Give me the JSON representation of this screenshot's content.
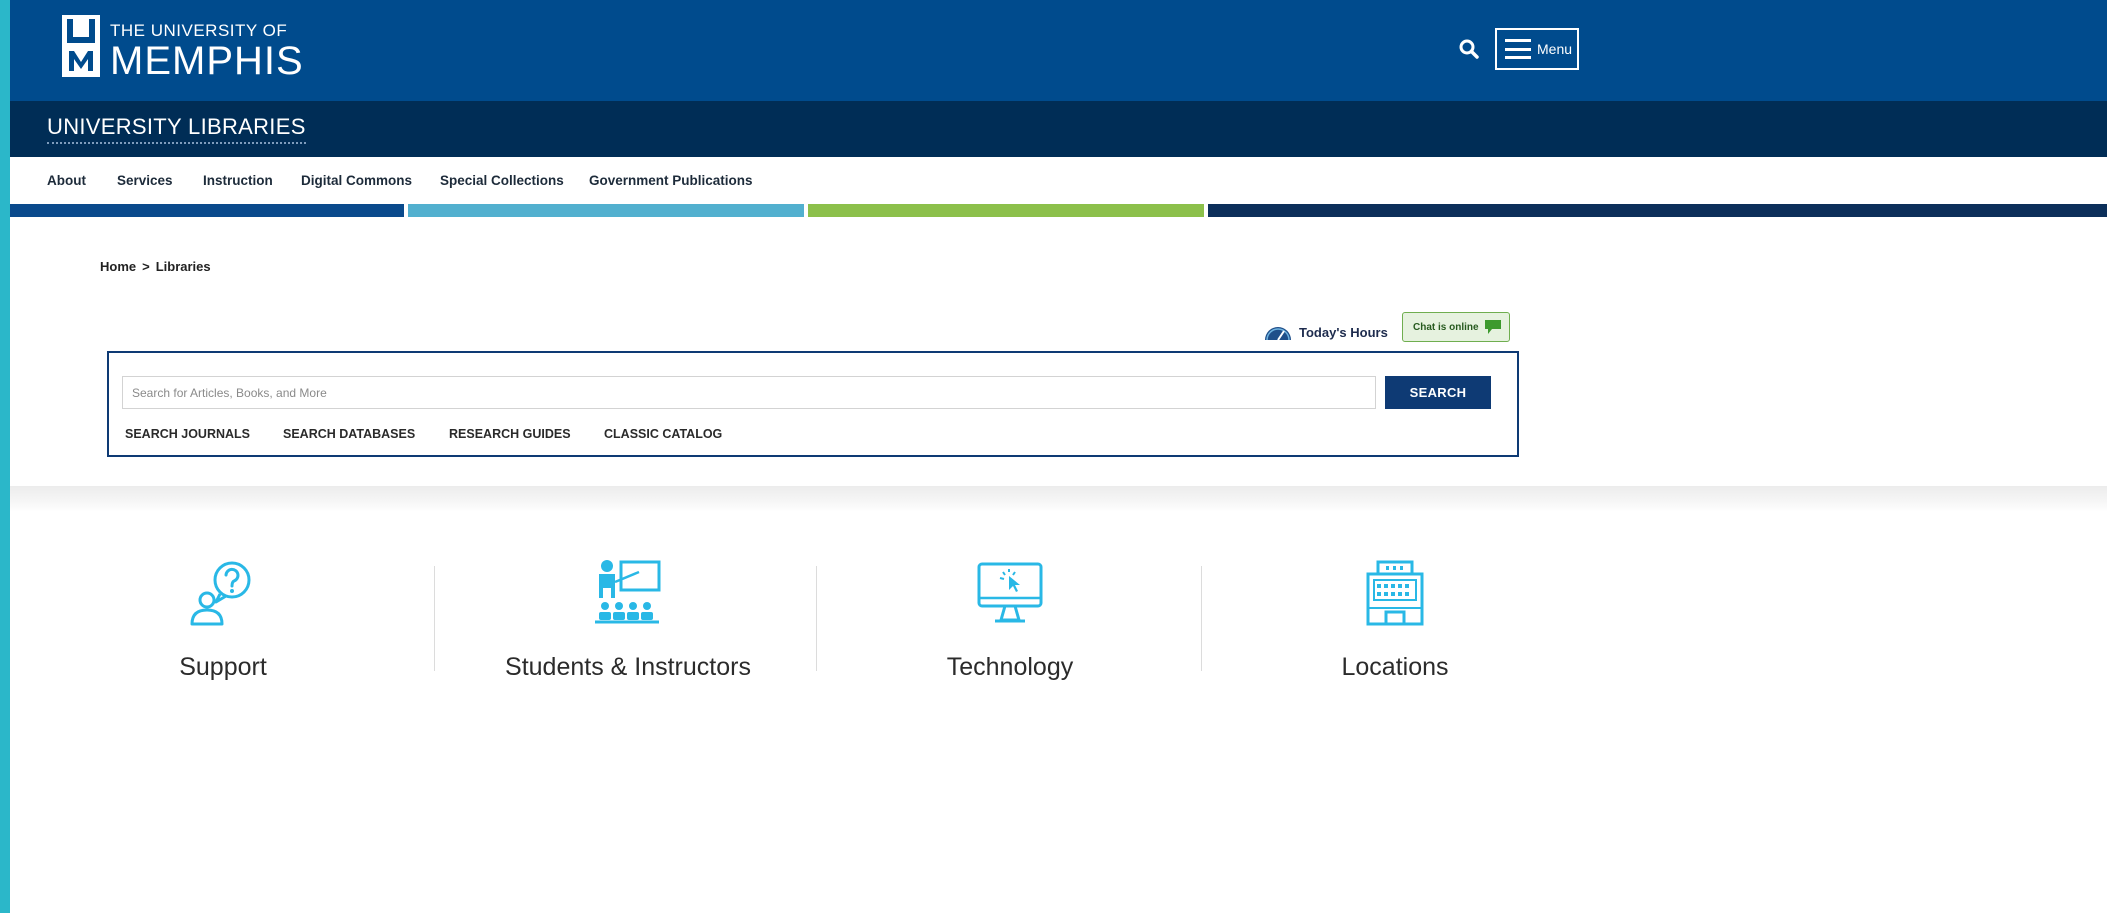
{
  "header": {
    "logo_line1": "THE UNIVERSITY OF",
    "logo_line2": "MEMPHIS",
    "menu_label": "Menu"
  },
  "subheader": {
    "title": "UNIVERSITY LIBRARIES"
  },
  "nav": {
    "items": [
      "About",
      "Services",
      "Instruction",
      "Digital Commons",
      "Special Collections",
      "Government Publications"
    ]
  },
  "colors": {
    "primary_blue": "#004b8d",
    "navy": "#002d56",
    "band_colors": [
      "#0a4a8c",
      "#52b0cf",
      "#8cc04b",
      "#0c2f5a"
    ],
    "icon_cyan": "#29b8e6"
  },
  "breadcrumb": {
    "items": [
      "Home",
      "Libraries"
    ],
    "separator": ">"
  },
  "utilities": {
    "hours_label": "Today's Hours",
    "chat_label": "Chat is online"
  },
  "search": {
    "placeholder": "Search for Articles, Books, and More",
    "value": "",
    "button_label": "SEARCH",
    "quick_links": [
      "SEARCH JOURNALS",
      "SEARCH DATABASES",
      "RESEARCH GUIDES",
      "CLASSIC CATALOG"
    ]
  },
  "cards": [
    {
      "label": "Support",
      "icon": "support-icon"
    },
    {
      "label": "Students & Instructors",
      "icon": "instructor-icon"
    },
    {
      "label": "Technology",
      "icon": "computer-icon"
    },
    {
      "label": "Locations",
      "icon": "building-icon"
    }
  ]
}
